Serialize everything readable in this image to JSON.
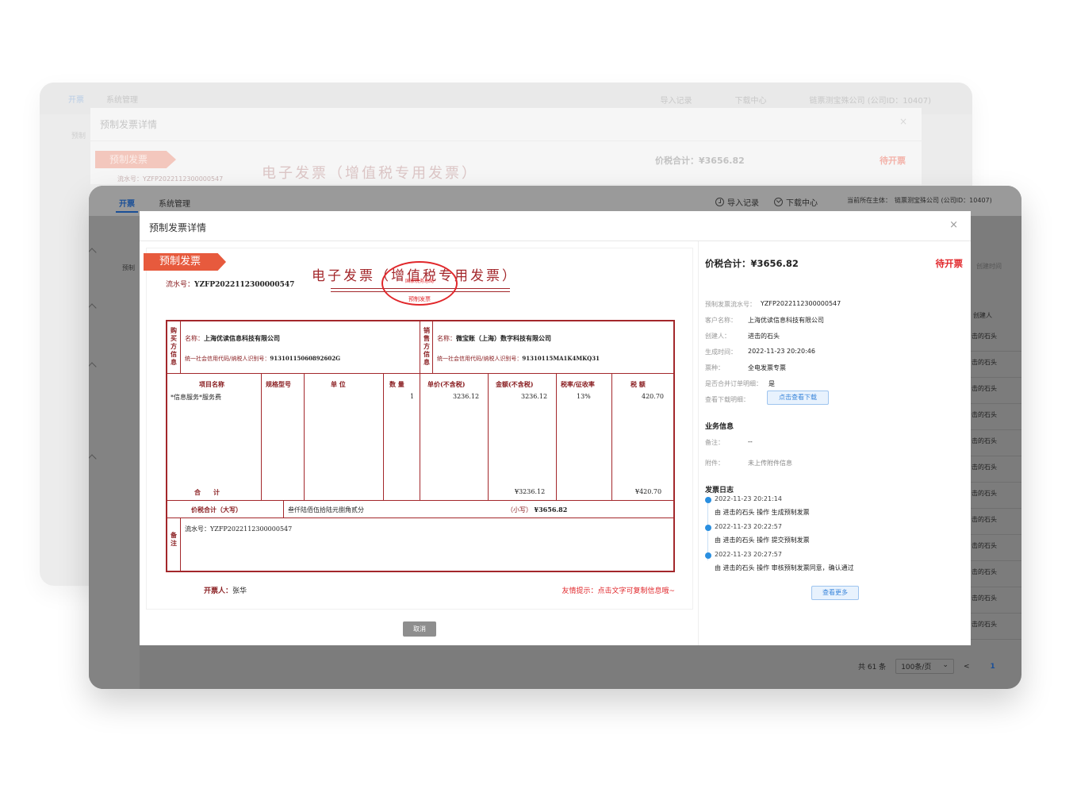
{
  "top_nav": {
    "tab_open": "开票",
    "tab_system": "系统管理",
    "import_records": "导入记录",
    "download_center": "下载中心",
    "current_entity": "当前所在主体：",
    "entity_name": "链票测宝殊公司 (公司ID：10407)"
  },
  "modal": {
    "title": "预制发票详情",
    "close": "×",
    "cancel": "取消"
  },
  "invoice": {
    "ribbon": "预制发票",
    "serial_label": "流水号：",
    "serial_no": "YZFP2022112300000547",
    "title": "电子发票（增值税专用发票）",
    "stamp_top": "国家税务总局",
    "stamp_bottom": "预制发票",
    "buyer_vlabel": "购买方信息",
    "seller_vlabel": "销售方信息",
    "buyer_name_label": "名称：",
    "buyer_name": "上海优读信息科技有限公司",
    "buyer_tax_label": "统一社会信用代码/纳税人识别号：",
    "buyer_tax": "91310115060892602G",
    "seller_name_label": "名称：",
    "seller_name": "微宝账（上海）数字科技有限公司",
    "seller_tax_label": "统一社会信用代码/纳税人识别号：",
    "seller_tax": "91310115MA1K4MKQ31",
    "headers": [
      "项目名称",
      "规格型号",
      "单 位",
      "数 量",
      "单价(不含税)",
      "金额(不含税)",
      "税率/征收率",
      "税 额"
    ],
    "item": {
      "name": "*信息服务*服务费",
      "spec": "",
      "unit": "",
      "qty": "1",
      "price": "3236.12",
      "amount": "3236.12",
      "rate": "13%",
      "tax": "420.70"
    },
    "subtotal_label": "合　　计",
    "subtotal_amount": "¥3236.12",
    "subtotal_tax": "¥420.70",
    "total_label": "价税合计（大写）",
    "total_caps": "叁仟陆佰伍拾陆元捌角贰分",
    "total_small_label": "（小写）",
    "total_small": "¥3656.82",
    "remark_vlabel": "备注",
    "remark": "流水号：YZFP2022112300000547",
    "issuer_label": "开票人：",
    "issuer": "张华",
    "tip": "友情提示：点击文字可复制信息哦~"
  },
  "details": {
    "amount_label": "价税合计：",
    "amount": "¥3656.82",
    "status": "待开票",
    "fields": [
      {
        "k": "预制发票流水号：",
        "v": "YZFP2022112300000547"
      },
      {
        "k": "客户名称：",
        "v": "上海优读信息科技有限公司"
      },
      {
        "k": "创建人：",
        "v": "进击的石头"
      },
      {
        "k": "生成时间：",
        "v": "2022-11-23 20:20:46"
      },
      {
        "k": "票种：",
        "v": "全电发票专票"
      },
      {
        "k": "是否合并订单明细：",
        "v": "是"
      },
      {
        "k": "查看下载明细：",
        "v": ""
      }
    ],
    "download_btn": "点击查看下载",
    "biz_title": "业务信息",
    "remark_k": "备注：",
    "remark_v": "--",
    "attach_k": "附件：",
    "attach_v": "未上传附件信息",
    "log_title": "发票日志",
    "logs": [
      {
        "time": "2022-11-23 20:21:14",
        "action": "由 进击的石头 操作 生成预制发票"
      },
      {
        "time": "2022-11-23 20:22:57",
        "action": "由 进击的石头 操作 提交预制发票"
      },
      {
        "time": "2022-11-23 20:27:57",
        "action": "由 进击的石头 操作 审核预制发票同意，确认通过"
      }
    ],
    "more_btn": "查看更多"
  },
  "background_table": {
    "creator_header": "创建人",
    "time_header": "创建时间",
    "cells": [
      "击的石头",
      "击的石头",
      "击的石头",
      "击的石头",
      "击的石头",
      "击的石头",
      "击的石头",
      "击的石头",
      "击的石头",
      "击的石头",
      "击的石头",
      "击的石头"
    ],
    "sidebar_label": "预制"
  },
  "pagination": {
    "total": "共 61 条",
    "page_size": "100条/页",
    "prev": "<",
    "page": "1"
  }
}
